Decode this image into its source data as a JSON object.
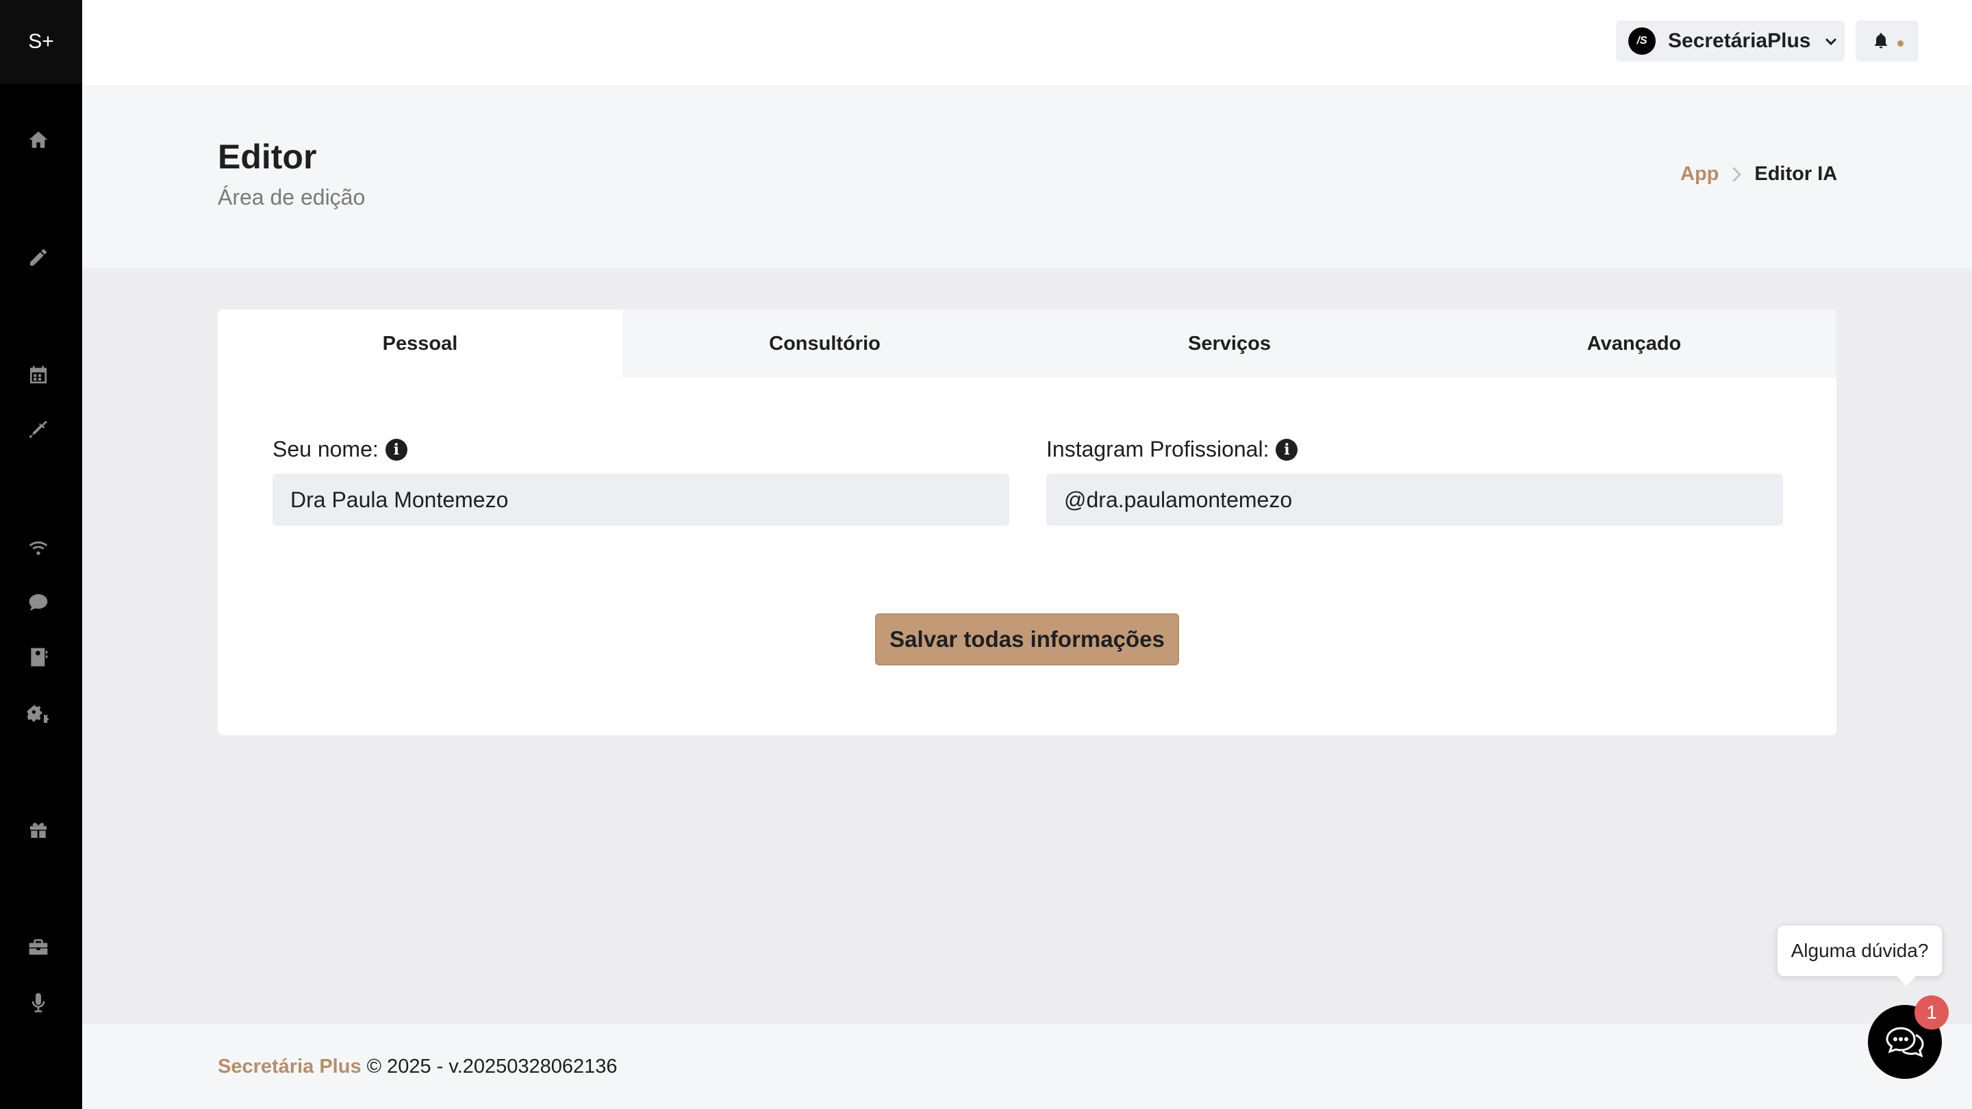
{
  "sidebar": {
    "logo": "S+",
    "items": [
      {
        "icon": "home-icon"
      },
      {
        "icon": "pencil-icon"
      },
      {
        "icon": "calendar-icon"
      },
      {
        "icon": "syringe-icon"
      },
      {
        "icon": "wifi-icon"
      },
      {
        "icon": "chat-icon"
      },
      {
        "icon": "contacts-icon"
      },
      {
        "icon": "gears-icon"
      },
      {
        "icon": "gift-icon"
      },
      {
        "icon": "briefcase-icon"
      },
      {
        "icon": "microphone-icon"
      }
    ]
  },
  "header": {
    "account_name": "SecretáriaPlus",
    "avatar_initials": "/S"
  },
  "page": {
    "title": "Editor",
    "subtitle": "Área de edição",
    "breadcrumb": {
      "root": "App",
      "current": "Editor IA"
    }
  },
  "tabs": [
    {
      "label": "Pessoal",
      "active": true
    },
    {
      "label": "Consultório",
      "active": false
    },
    {
      "label": "Serviços",
      "active": false
    },
    {
      "label": "Avançado",
      "active": false
    }
  ],
  "form": {
    "name_label": "Seu nome:",
    "name_value": "Dra Paula Montemezo",
    "instagram_label": "Instagram Profissional:",
    "instagram_value": "@dra.paulamontemezo",
    "save_label": "Salvar todas informações"
  },
  "footer": {
    "brand": "Secretária Plus",
    "text": " © 2025 - v.20250328062136"
  },
  "chat": {
    "tooltip": "Alguma dúvida?",
    "badge": "1"
  },
  "colors": {
    "accent": "#c29a77",
    "link": "#b58e6a",
    "sidebar": "#000000",
    "badge": "#e05a5a"
  }
}
